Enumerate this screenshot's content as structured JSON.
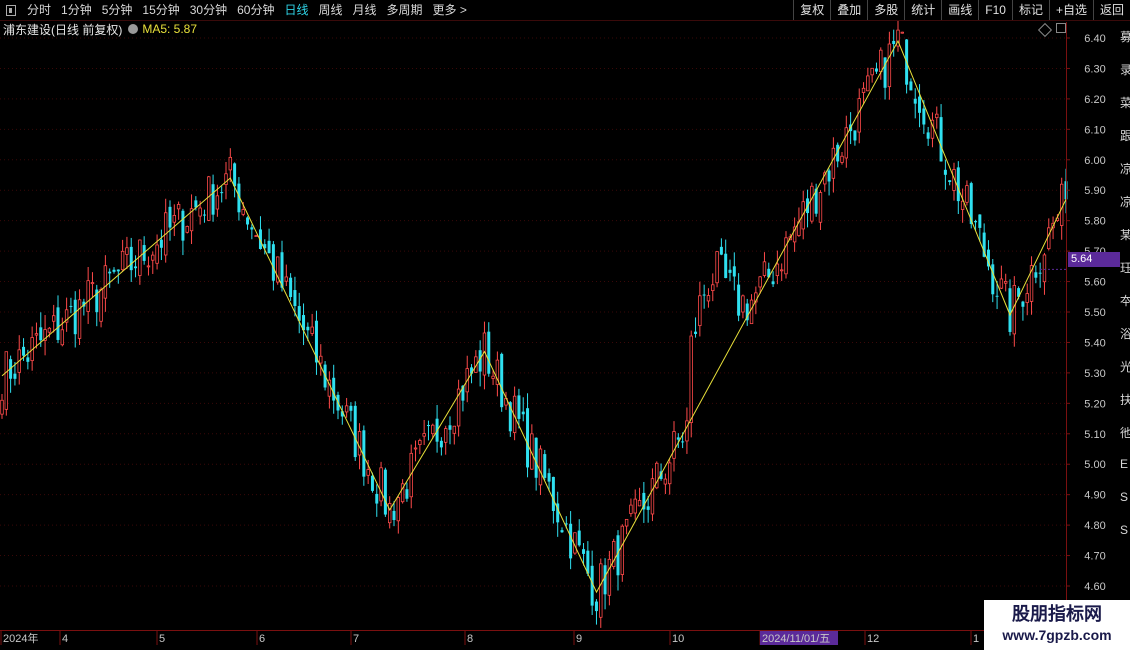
{
  "toolbar": {
    "tabs": [
      "分时",
      "1分钟",
      "5分钟",
      "15分钟",
      "30分钟",
      "60分钟",
      "日线",
      "周线",
      "月线",
      "多周期",
      "更多 >"
    ],
    "active_tab": "日线",
    "right_buttons": [
      "复权",
      "叠加",
      "多股",
      "统计",
      "画线",
      "F10",
      "标记",
      "+自选",
      "返回"
    ]
  },
  "subheader": {
    "title": "浦东建设(日线 前复权)",
    "ma_label": "MA5: 5.87"
  },
  "price_tag": "5.64",
  "right_strip_chars": [
    "募",
    "录",
    "菜",
    "跟",
    "凉",
    "凉",
    "某",
    "珏",
    "夲",
    "浴",
    "光",
    "扶",
    "彵",
    "E",
    "S",
    "S"
  ],
  "watermark": {
    "cn": "股朋指标网",
    "url": "www.7gpzb.com"
  },
  "colors": {
    "up": "#ff4a4a",
    "down": "#2fe0f0",
    "zigzag": "#e8e03a",
    "axis": "#7a1010",
    "label": "#c8c8c8"
  },
  "chart_data": {
    "type": "candlestick",
    "y_ticks": [
      "6.40",
      "6.30",
      "6.20",
      "6.10",
      "6.00",
      "5.90",
      "5.80",
      "5.70",
      "5.60",
      "5.50",
      "5.40",
      "5.30",
      "5.20",
      "5.10",
      "5.00",
      "4.90",
      "4.80",
      "4.70",
      "4.60"
    ],
    "ylim": [
      4.55,
      6.43
    ],
    "x_labels": [
      "2024年",
      "4",
      "5",
      "6",
      "7",
      "8",
      "9",
      "10",
      "2024/11/01/五",
      "12",
      "1"
    ],
    "highlight_x_label": "2024/11/01/五",
    "last_price": 5.64,
    "zigzag": [
      {
        "i": 0,
        "v": 5.29
      },
      {
        "i": 53,
        "v": 5.94
      },
      {
        "i": 90,
        "v": 4.85
      },
      {
        "i": 112,
        "v": 5.37
      },
      {
        "i": 138,
        "v": 4.58
      },
      {
        "i": 208,
        "v": 6.39
      },
      {
        "i": 234,
        "v": 5.49
      },
      {
        "i": 247,
        "v": 5.87
      }
    ]
  }
}
